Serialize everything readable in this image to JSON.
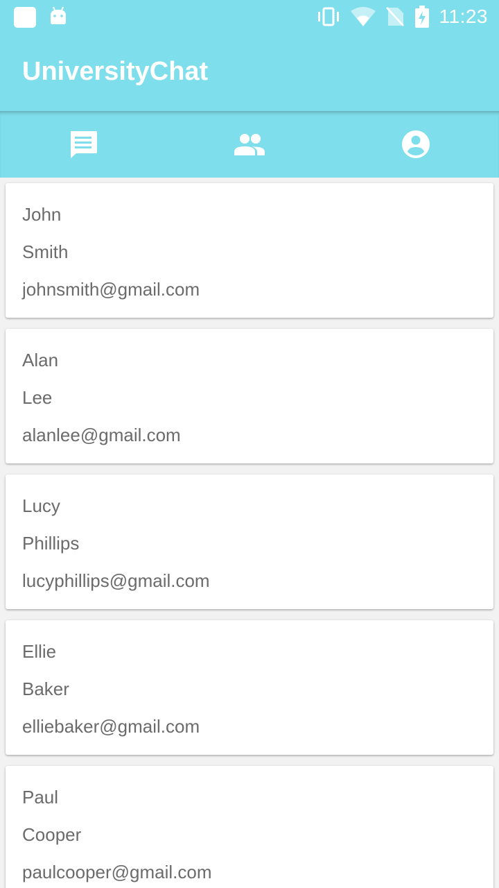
{
  "status_bar": {
    "time": "11:23",
    "icons": [
      "app-square-icon",
      "android-icon",
      "vibrate-icon",
      "wifi-icon",
      "no-sim-icon",
      "battery-charging-icon"
    ]
  },
  "app_bar": {
    "title": "UniversityChat"
  },
  "tabs": [
    {
      "icon": "chat-icon"
    },
    {
      "icon": "people-icon"
    },
    {
      "icon": "account-circle-icon"
    }
  ],
  "users": [
    {
      "first_name": "John",
      "last_name": "Smith",
      "email": "johnsmith@gmail.com"
    },
    {
      "first_name": "Alan",
      "last_name": "Lee",
      "email": "alanlee@gmail.com"
    },
    {
      "first_name": "Lucy",
      "last_name": "Phillips",
      "email": "lucyphillips@gmail.com"
    },
    {
      "first_name": "Ellie",
      "last_name": "Baker",
      "email": "elliebaker@gmail.com"
    },
    {
      "first_name": "Paul",
      "last_name": "Cooper",
      "email": "paulcooper@gmail.com"
    }
  ],
  "colors": {
    "primary": "#7fdeeb",
    "on_primary": "#ffffff",
    "text_secondary": "#6b6b6b",
    "background": "#f2f2f2"
  }
}
